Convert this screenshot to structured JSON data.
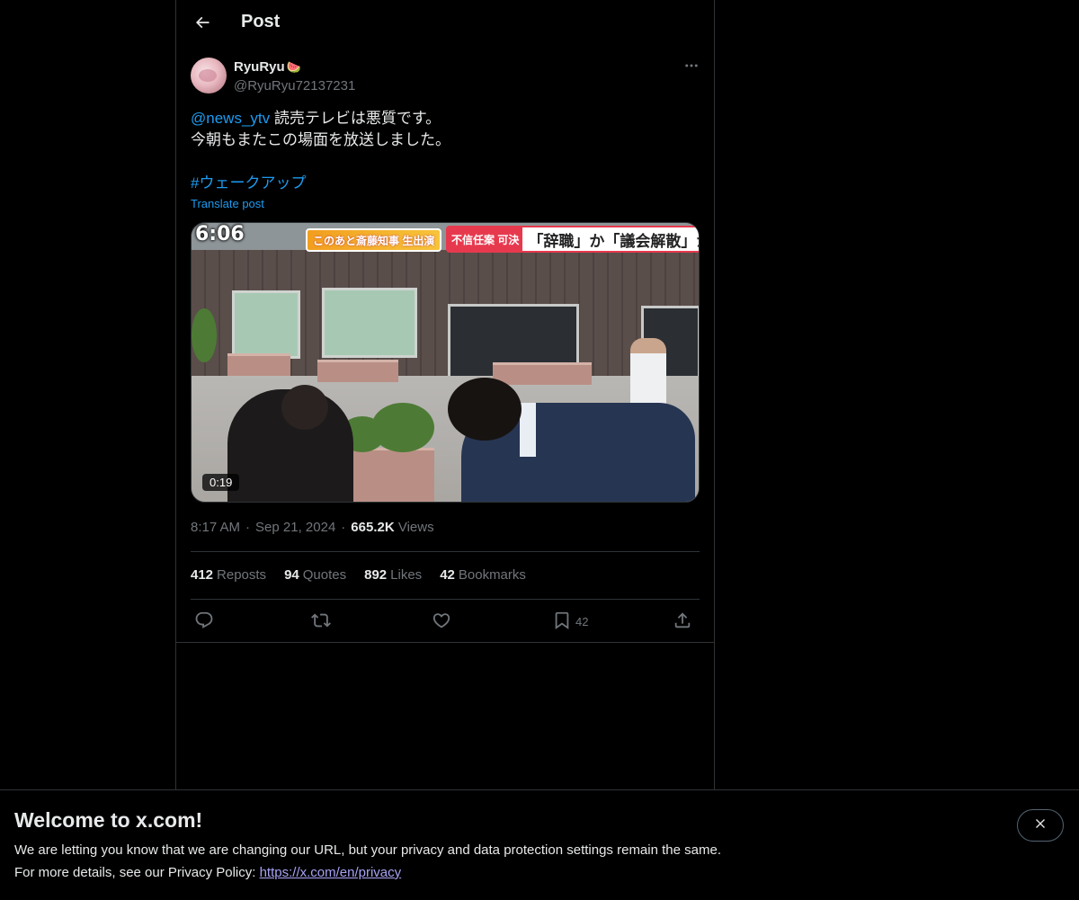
{
  "header": {
    "title": "Post",
    "back_icon": "arrow-left-icon"
  },
  "post": {
    "author": {
      "display_name": "RyuRyu",
      "emoji": "🍉",
      "handle": "@RyuRyu72137231"
    },
    "text": {
      "mention": "@news_ytv",
      "line1_rest": " 読売テレビは悪質です。",
      "line2": "今朝もまたこの場面を放送しました。",
      "hashtag": "#ウェークアップ"
    },
    "translate_label": "Translate post",
    "media": {
      "type": "video",
      "duration": "0:19",
      "overlay_clock": "6:06",
      "overlay_chyron_left": "このあと斎藤知事 生出演",
      "overlay_chyron_tag": "不信任案 可決",
      "overlay_chyron_right": "「辞職」か「議会解散」か"
    },
    "meta": {
      "time": "8:17 AM",
      "separator": "·",
      "date": "Sep 21, 2024",
      "views_count": "665.2K",
      "views_label": "Views"
    },
    "stats": [
      {
        "count": "412",
        "label": "Reposts"
      },
      {
        "count": "94",
        "label": "Quotes"
      },
      {
        "count": "892",
        "label": "Likes"
      },
      {
        "count": "42",
        "label": "Bookmarks"
      }
    ],
    "actions": {
      "reply_icon": "reply-icon",
      "repost_icon": "repost-icon",
      "like_icon": "heart-icon",
      "bookmark_icon": "bookmark-icon",
      "bookmark_count": "42",
      "share_icon": "share-icon"
    }
  },
  "banner": {
    "title": "Welcome to x.com!",
    "line1": "We are letting you know that we are changing our URL, but your privacy and data protection settings remain the same.",
    "line2_prefix": "For more details, see our Privacy Policy: ",
    "link": "https://x.com/en/privacy",
    "close_icon": "close-icon"
  },
  "colors": {
    "background": "#000000",
    "text_primary": "#e7e9ea",
    "text_secondary": "#71767b",
    "accent": "#1d9bf0",
    "border": "#2f3336",
    "link_banner": "#a8a3f5"
  }
}
